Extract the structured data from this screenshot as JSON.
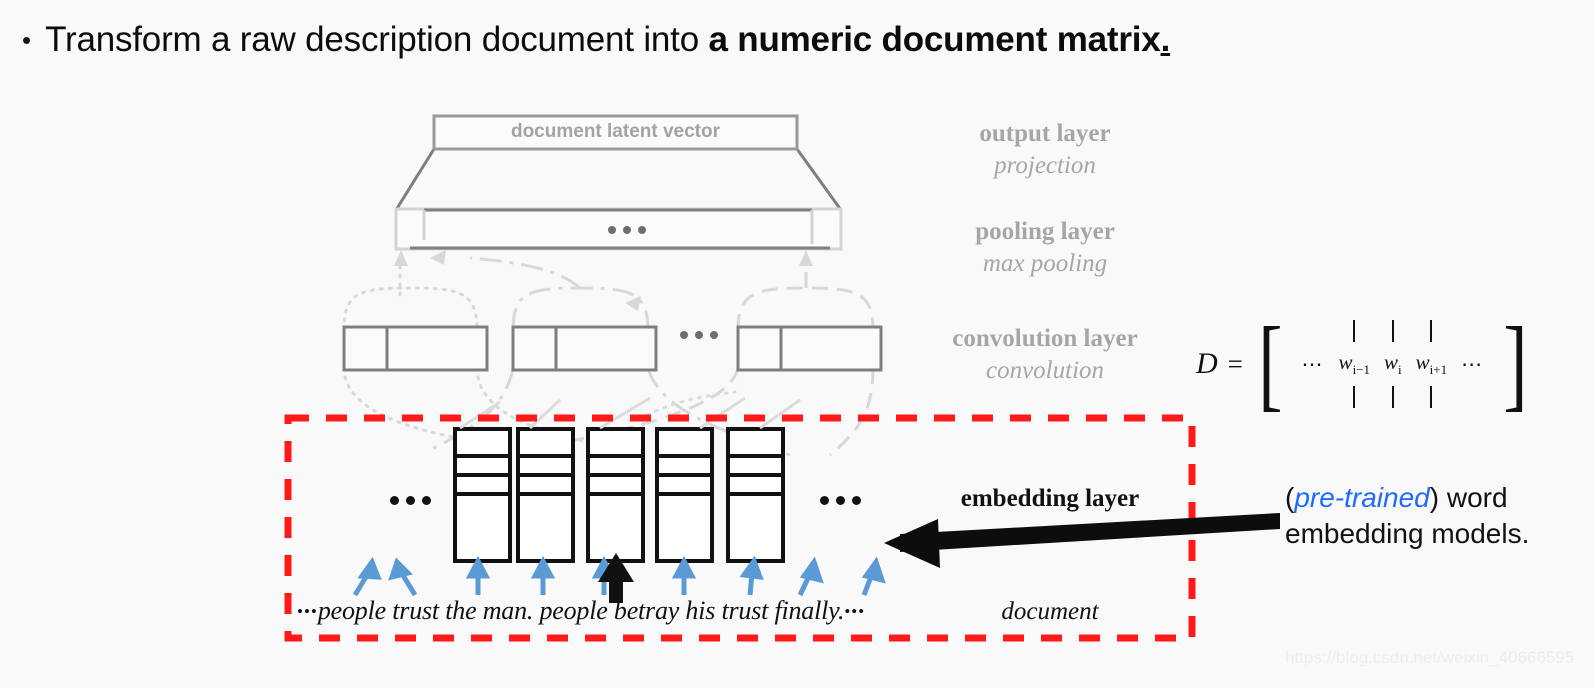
{
  "slide": {
    "background_color": "#f9f9f9",
    "title": {
      "bullet": "•",
      "lead_text": "Transform a raw description document into ",
      "bold_text": "a numeric document matrix",
      "bold_period": "."
    }
  },
  "diagram": {
    "latent_vector_label": "document latent vector",
    "layers": [
      {
        "name": "output layer",
        "operation": "projection"
      },
      {
        "name": "pooling layer",
        "operation": "max pooling"
      },
      {
        "name": "convolution layer",
        "operation": "convolution"
      }
    ],
    "embedding_layer_label": "embedding layer",
    "document_label": "document",
    "ellipsis": "•••",
    "embedding_column_count": 5,
    "embedding_cells_per_column": 4,
    "blue_arrow_count": 9,
    "red_box_color": "#ff1a1a",
    "blue_arrow_color": "#5b9bd5",
    "gray_line_color": "#9a9a9a",
    "black_color": "#111111"
  },
  "sentence": {
    "leading_dots": "•••",
    "text": "people trust the man. people betray his trust finally.",
    "trailing_dots": "•••"
  },
  "matrix": {
    "lhs": "D",
    "equals": "=",
    "left_bracket": "[",
    "right_bracket": "]",
    "leading_dots": "⋯",
    "columns": [
      {
        "label": "w",
        "sub": "i−1"
      },
      {
        "label": "w",
        "sub": "i"
      },
      {
        "label": "w",
        "sub": "i+1"
      }
    ],
    "trailing_dots": "⋯"
  },
  "annotation": {
    "open_paren": "(",
    "emphasis": "pre-trained",
    "close_paren": ")",
    "rest_line1": " word",
    "line2": "embedding models."
  },
  "watermark": {
    "text": "https://blog.csdn.net/weixin_40666595"
  }
}
